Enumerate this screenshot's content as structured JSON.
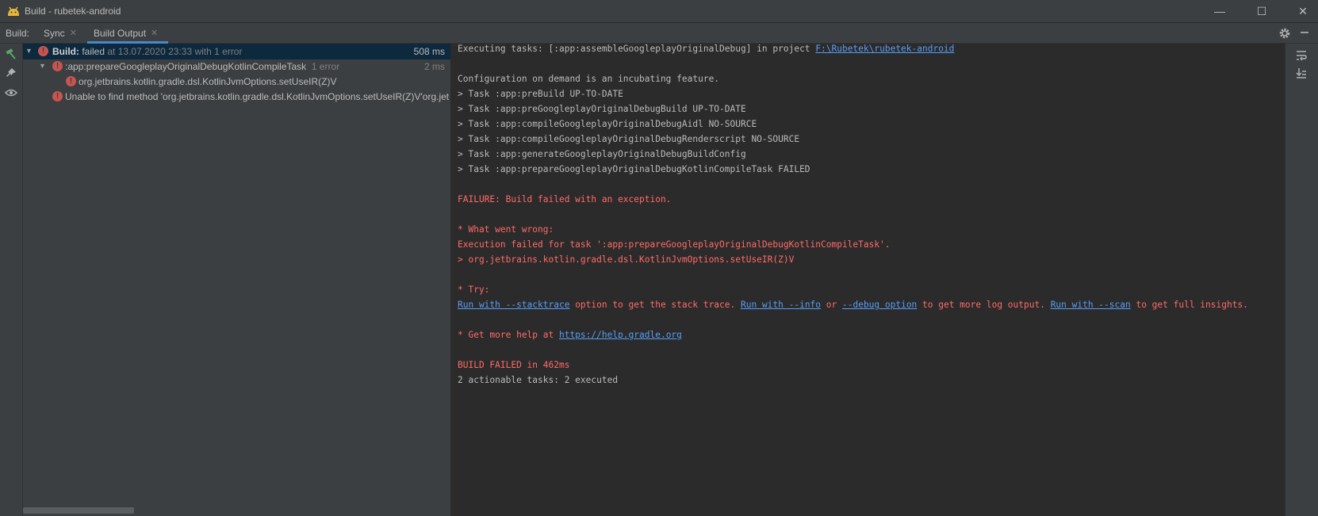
{
  "window": {
    "title": "Build - rubetek-android",
    "minimize": "—",
    "maximize": "☐",
    "close": "✕"
  },
  "tabs": {
    "label": "Build:",
    "items": [
      {
        "label": "Sync",
        "close": "✕"
      },
      {
        "label": "Build Output",
        "close": "✕"
      }
    ]
  },
  "tools": {
    "left": [
      "hammer-icon",
      "pin-icon",
      "eye-icon"
    ],
    "right": [
      "soft-wrap-icon",
      "scroll-to-end-icon"
    ],
    "settings": "gear-icon"
  },
  "tree": {
    "root": {
      "label_bold": "Build:",
      "label_status": " failed",
      "label_rest": " at 13.07.2020 23:33 with 1 error",
      "time": "508 ms"
    },
    "task": {
      "label": ":app:prepareGoogleplayOriginalDebugKotlinCompileTask",
      "count": "1 error",
      "time": "2 ms"
    },
    "task_child": {
      "label": "org.jetbrains.kotlin.gradle.dsl.KotlinJvmOptions.setUseIR(Z)V"
    },
    "error_row": {
      "label": "Unable to find method 'org.jetbrains.kotlin.gradle.dsl.KotlinJvmOptions.setUseIR(Z)V'org.jet"
    }
  },
  "console": {
    "exec_prefix": "Executing tasks: [:app:assembleGoogleplayOriginalDebug] in project ",
    "exec_link": "F:\\Rubetek\\rubetek-android",
    "config": "Configuration on demand is an incubating feature.",
    "tasks": [
      "> Task :app:preBuild UP-TO-DATE",
      "> Task :app:preGoogleplayOriginalDebugBuild UP-TO-DATE",
      "> Task :app:compileGoogleplayOriginalDebugAidl NO-SOURCE",
      "> Task :app:compileGoogleplayOriginalDebugRenderscript NO-SOURCE",
      "> Task :app:generateGoogleplayOriginalDebugBuildConfig",
      "> Task :app:prepareGoogleplayOriginalDebugKotlinCompileTask FAILED"
    ],
    "failure": "FAILURE: Build failed with an exception.",
    "wrong_header": "* What went wrong:",
    "wrong_line1": "Execution failed for task ':app:prepareGoogleplayOriginalDebugKotlinCompileTask'.",
    "wrong_line2": "> org.jetbrains.kotlin.gradle.dsl.KotlinJvmOptions.setUseIR(Z)V",
    "try_header": "* Try:",
    "try_link1": "Run with --stacktrace",
    "try_text1": " option to get the stack trace. ",
    "try_link2": "Run with --info",
    "try_text2": " or ",
    "try_link3": "--debug option",
    "try_text3": " to get more log output. ",
    "try_link4": "Run with --scan",
    "try_text4": " to get full insights.",
    "help_prefix": "* Get more help at ",
    "help_link": "https://help.gradle.org",
    "build_failed": "BUILD FAILED in 462ms",
    "actionable": "2 actionable tasks: 2 executed"
  }
}
